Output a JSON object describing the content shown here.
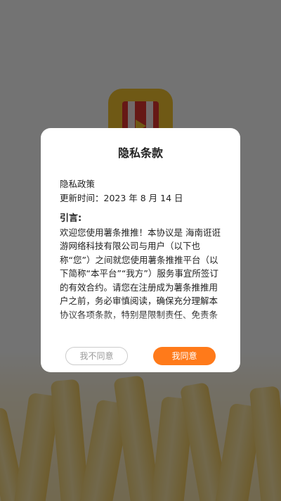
{
  "dialog": {
    "title": "隐私条款",
    "policy_name": "隐私政策",
    "updated": "更新时间：2023 年 8 月 14 日",
    "intro_heading": "引言:",
    "intro_text": "欢迎您使用薯条推推！本协议是 海南诳诳游网络科技有限公司与用户（以下也称“您”）之间就您使用薯条推推平台（以下简称“本平台”“我方”）服务事宜所签订的有效合约。请您在注册成为薯条推推用户之前，务必审慎阅读，确保充分理解本协议各项条款，特别是限制责任、免责条款、违约责任、争议解决条款，并选择接受或不接受。加黑标记、请您在阅读",
    "disagree_label": "我不同意",
    "agree_label": "我同意"
  },
  "colors": {
    "accent": "#ff7a1a",
    "logo_yellow": "#f7c52f",
    "logo_red": "#e2362f"
  }
}
